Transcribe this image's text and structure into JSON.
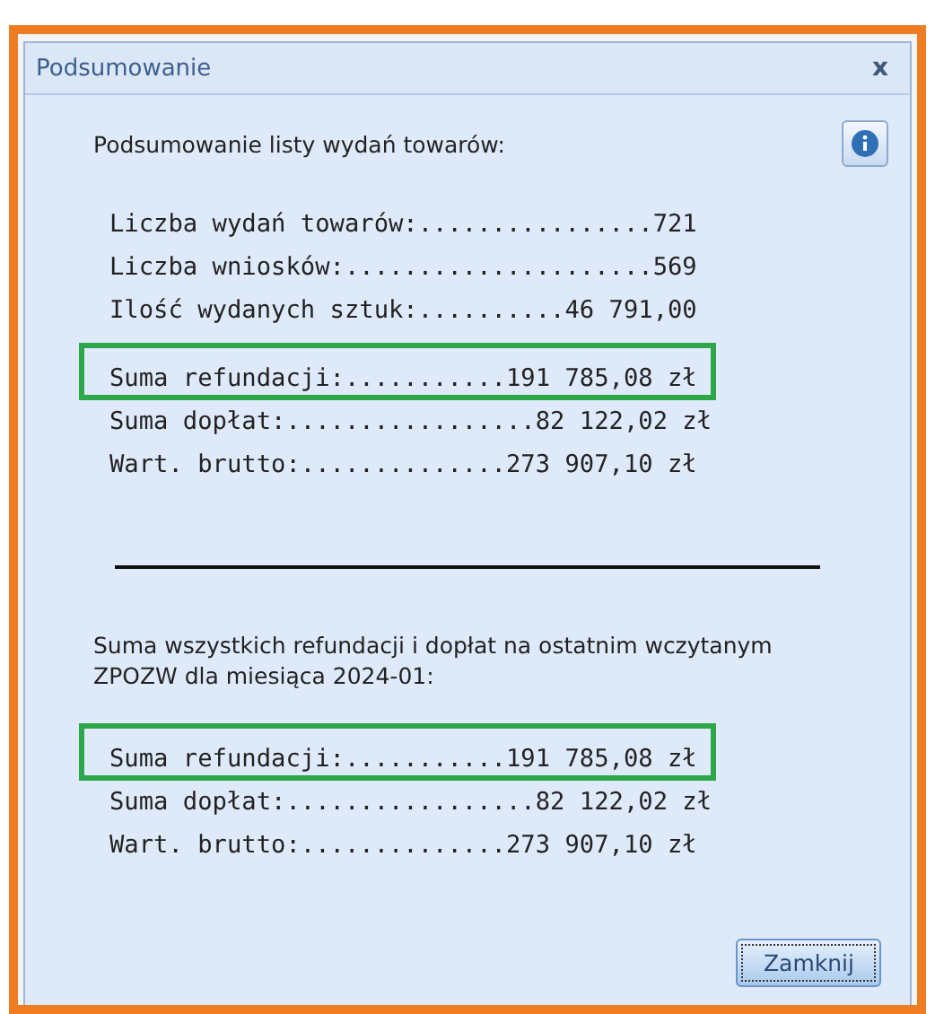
{
  "window": {
    "title": "Podsumowanie",
    "close": "x"
  },
  "intro": "Podsumowanie listy wydań towarów:",
  "groups": [
    [
      {
        "text": "Liczba wydań towarów:................721",
        "highlighted": false
      },
      {
        "text": "Liczba wniosków:.....................569",
        "highlighted": false
      },
      {
        "text": "Ilość wydanych sztuk:..........46 791,00",
        "highlighted": false
      }
    ],
    [
      {
        "text": "Suma refundacji:...........191 785,08 zł",
        "highlighted": true
      },
      {
        "text": "Suma dopłat:.................82 122,02 zł",
        "highlighted": false
      },
      {
        "text": "Wart. brutto:..............273 907,10 zł",
        "highlighted": false
      }
    ]
  ],
  "month_note": "Suma wszystkich refundacji i dopłat na ostatnim wczytanym ZPOZW dla miesiąca 2024-01:",
  "month_lines": [
    {
      "text": "Suma refundacji:...........191 785,08 zł",
      "highlighted": true
    },
    {
      "text": "Suma dopłat:.................82 122,02 zł",
      "highlighted": false
    },
    {
      "text": "Wart. brutto:..............273 907,10 zł",
      "highlighted": false
    }
  ],
  "buttons": [
    {
      "label": "Zamknij",
      "focused": true
    }
  ]
}
